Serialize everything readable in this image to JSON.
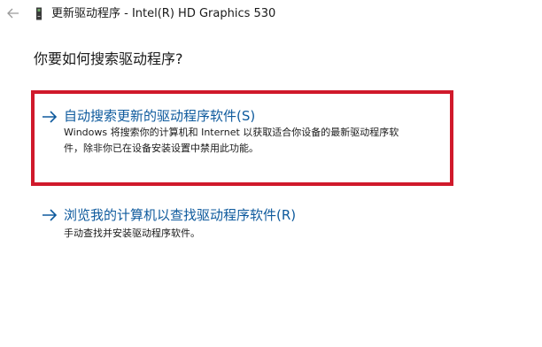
{
  "window": {
    "title": "更新驱动程序 - Intel(R) HD Graphics 530",
    "back_icon": "back-arrow-icon",
    "device_icon": "display-adapter-icon"
  },
  "question": "你要如何搜索驱动程序?",
  "options": [
    {
      "title": "自动搜索更新的驱动程序软件(S)",
      "description_line1": "Windows 将搜索你的计算机和 Internet 以获取适合你设备的最新驱动程序软",
      "description_line2": "件，除非你已在设备安装设置中禁用此功能。",
      "highlighted": true
    },
    {
      "title": "浏览我的计算机以查找驱动程序软件(R)",
      "description_line1": "手动查找并安装驱动程序软件。",
      "highlighted": false
    }
  ],
  "colors": {
    "link": "#0e5a9d",
    "highlight_frame": "#d0192b",
    "text": "#1a1a1a",
    "background": "#ffffff"
  }
}
